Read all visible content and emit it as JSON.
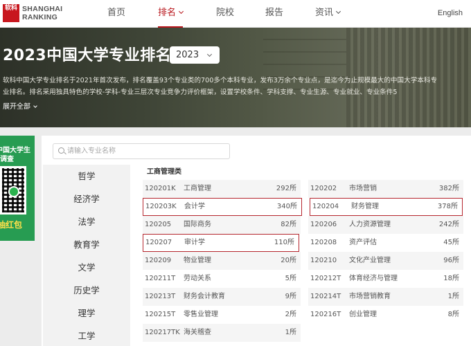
{
  "logo": {
    "mark": "软科",
    "line1": "SHANGHAI",
    "line2": "RANKING"
  },
  "nav": {
    "items": [
      {
        "label": "首页",
        "has_dropdown": false,
        "active": false
      },
      {
        "label": "排名",
        "has_dropdown": true,
        "active": true
      },
      {
        "label": "院校",
        "has_dropdown": false,
        "active": false
      },
      {
        "label": "报告",
        "has_dropdown": false,
        "active": false
      },
      {
        "label": "资讯",
        "has_dropdown": true,
        "active": false
      }
    ],
    "language": "English"
  },
  "hero": {
    "title": "2023中国大学专业排名",
    "year": "2023",
    "description": "软科中国大学专业排名于2021年首次发布，排名覆盖93个专业类的700多个本科专业，发布3万余个专业点，是迄今为止规模最大的中国大学本科专业排名。排名采用独具特色的学校-学科-专业三层次专业竞争力评价框架，设置学校条件、学科支撑、专业生源、专业就业、专业条件5",
    "expand_label": "展开全部"
  },
  "promo": {
    "line1": "中国大学生",
    "line2": "调查",
    "bottom": "抽红包"
  },
  "search": {
    "placeholder": "请输入专业名称",
    "value": ""
  },
  "categories": [
    "哲学",
    "经济学",
    "法学",
    "教育学",
    "文学",
    "历史学",
    "理学",
    "工学"
  ],
  "section": {
    "title": "工商管理类",
    "majors": [
      {
        "code": "120201K",
        "name": "工商管理",
        "count": "292所"
      },
      {
        "code": "120202",
        "name": "市场营销",
        "count": "382所"
      },
      {
        "code": "120203K",
        "name": "会计学",
        "count": "340所"
      },
      {
        "code": "120204",
        "name": "财务管理",
        "count": "378所"
      },
      {
        "code": "120205",
        "name": "国际商务",
        "count": "82所"
      },
      {
        "code": "120206",
        "name": "人力资源管理",
        "count": "242所"
      },
      {
        "code": "120207",
        "name": "审计学",
        "count": "110所"
      },
      {
        "code": "120208",
        "name": "资产评估",
        "count": "45所"
      },
      {
        "code": "120209",
        "name": "物业管理",
        "count": "20所"
      },
      {
        "code": "120210",
        "name": "文化产业管理",
        "count": "96所"
      },
      {
        "code": "120211T",
        "name": "劳动关系",
        "count": "5所"
      },
      {
        "code": "120212T",
        "name": "体育经济与管理",
        "count": "18所"
      },
      {
        "code": "120213T",
        "name": "财务会计教育",
        "count": "9所"
      },
      {
        "code": "120214T",
        "name": "市场营销教育",
        "count": "1所"
      },
      {
        "code": "120215T",
        "name": "零售业管理",
        "count": "2所"
      },
      {
        "code": "120216T",
        "name": "创业管理",
        "count": "8所"
      },
      {
        "code": "120217TK",
        "name": "海关稽查",
        "count": "1所"
      }
    ]
  },
  "colors": {
    "brand_red": "#b8151b",
    "highlight_border": "#b5252d",
    "promo_green": "#279c52"
  }
}
